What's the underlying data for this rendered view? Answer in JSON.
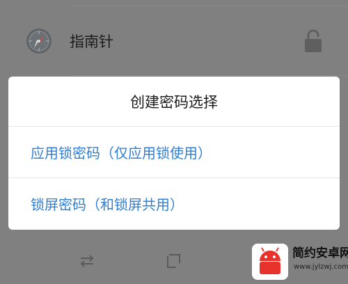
{
  "app_row": {
    "name": "指南针",
    "icon": "compass-icon",
    "lock_icon": "lock-open-icon"
  },
  "dialog": {
    "title": "创建密码选择",
    "options": [
      {
        "label": "应用锁密码（仅应用锁使用）"
      },
      {
        "label": "锁屏密码（和锁屏共用）"
      }
    ]
  },
  "navbar": {
    "buttons": [
      "swap-icon",
      "square-icon",
      "back-icon"
    ]
  },
  "watermark": {
    "text": "简约安卓网",
    "url": "www.jylzwj.com"
  },
  "colors": {
    "accent": "#2f7fd5",
    "overlay": "#808080",
    "dialog_bg": "#ffffff"
  }
}
